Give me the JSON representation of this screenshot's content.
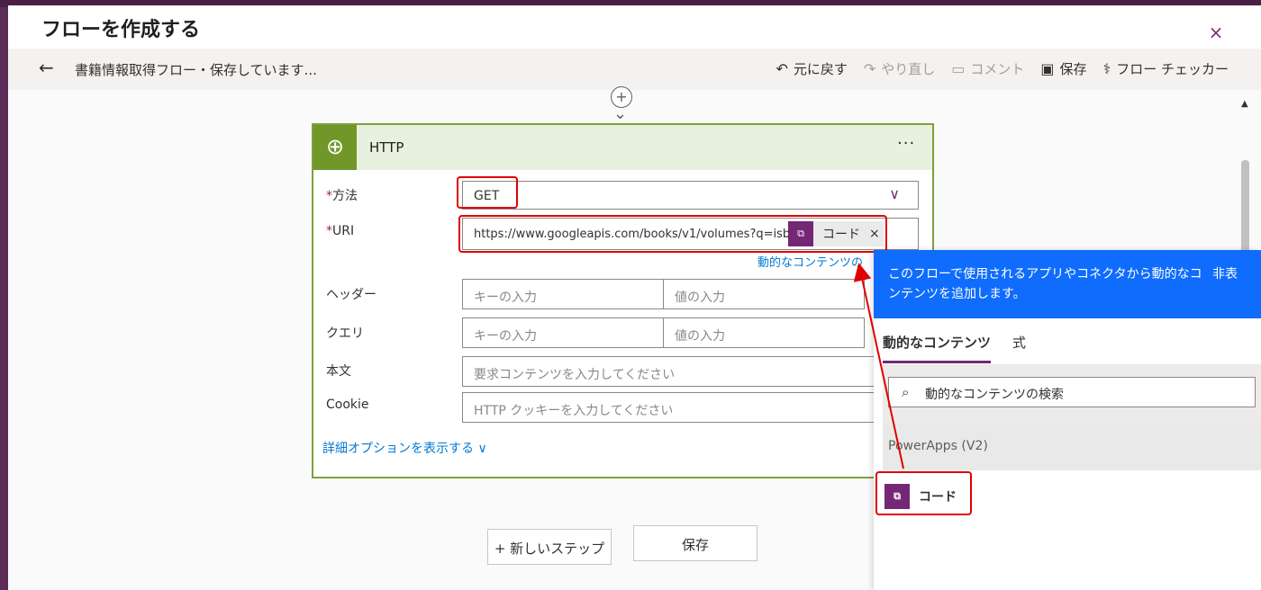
{
  "dialog": {
    "title": "フローを作成する",
    "close_icon": "×"
  },
  "cmdbar": {
    "back_icon": "←",
    "flow_name": "書籍情報取得フロー・保存しています...",
    "undo": "元に戻す",
    "redo": "やり直し",
    "comment": "コメント",
    "save": "保存",
    "checker": "フロー チェッカー"
  },
  "action": {
    "title": "HTTP",
    "more": "···",
    "method_label": "方法",
    "method_value": "GET",
    "uri_label": "URI",
    "uri_value": "https://www.googleapis.com/books/v1/volumes?q=isbn:",
    "token_label": "コード",
    "token_remove": "×",
    "dynamic_link": "動的なコンテンツの",
    "headers_label": "ヘッダー",
    "queries_label": "クエリ",
    "body_label": "本文",
    "cookie_label": "Cookie",
    "key_placeholder": "キーの入力",
    "value_placeholder": "値の入力",
    "body_placeholder": "要求コンテンツを入力してください",
    "cookie_placeholder": "HTTP クッキーを入力してください",
    "advanced": "詳細オプションを表示する"
  },
  "bottom": {
    "new_step": "+ 新しいステップ",
    "save": "保存"
  },
  "panel": {
    "description": "このフローで使用されるアプリやコネクタから動的なコンテンツを追加します。",
    "hide": "非表",
    "tab_dynamic": "動的なコンテンツ",
    "tab_expression": "式",
    "search_placeholder": "動的なコンテンツの検索",
    "group": "PowerApps (V2)",
    "item": "コード"
  },
  "colors": {
    "brand": "#742774",
    "http": "#709727",
    "highlight": "#e00000",
    "panel_header": "#0f6cfd"
  }
}
